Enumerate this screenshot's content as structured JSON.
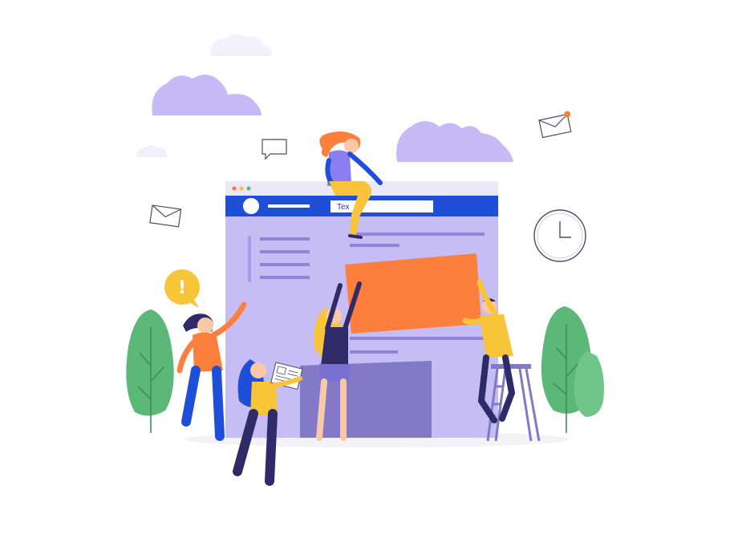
{
  "illustration": {
    "browser_window": {
      "address_input_text": "Tex",
      "window_buttons": [
        "close",
        "minimize",
        "maximize"
      ]
    },
    "speech_bubble_symbol": "!",
    "icons": [
      "mail-envelope-icon",
      "chat-bubble-icon",
      "clock-icon",
      "alert-bubble-icon",
      "cloud-icon",
      "tree-icon",
      "ladder-icon"
    ],
    "colors": {
      "accent_blue": "#1f4fd8",
      "window_lavender": "#c7bdf5",
      "panel_orange": "#fd7f3b",
      "cloud_purple": "#c8baf7",
      "tree_green": "#5cb878",
      "alert_yellow": "#f8c43a",
      "dark_navy": "#2f2a68"
    }
  }
}
